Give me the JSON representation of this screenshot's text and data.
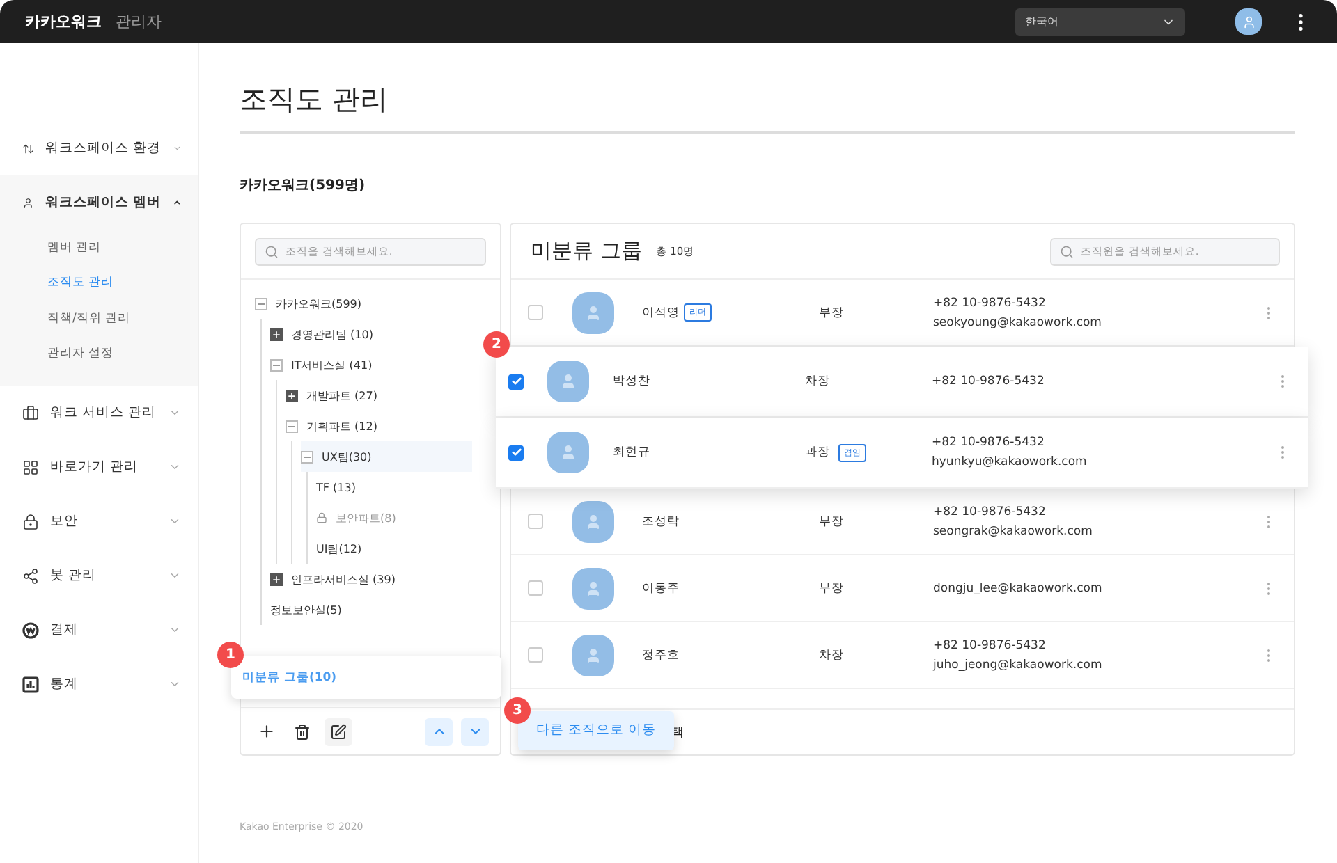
{
  "topbar": {
    "brand": "카카오워크",
    "subtitle": "관리자",
    "language": "한국어"
  },
  "sidebar": {
    "items": [
      {
        "label": "워크스페이스 환경",
        "expanded": false
      },
      {
        "label": "워크스페이스 멤버",
        "expanded": true,
        "children": [
          {
            "label": "멤버 관리",
            "selected": false
          },
          {
            "label": "조직도 관리",
            "selected": true
          },
          {
            "label": "직책/직위 관리",
            "selected": false
          },
          {
            "label": "관리자 설정",
            "selected": false
          }
        ]
      },
      {
        "label": "워크 서비스 관리",
        "expanded": false
      },
      {
        "label": "바로가기 관리",
        "expanded": false
      },
      {
        "label": "보안",
        "expanded": false
      },
      {
        "label": "봇 관리",
        "expanded": false
      },
      {
        "label": "결제",
        "expanded": false
      },
      {
        "label": "통계",
        "expanded": false
      }
    ]
  },
  "page": {
    "title": "조직도 관리",
    "org_label": "카카오워크(599명)",
    "footer": "Kakao Enterprise © 2020"
  },
  "tree_panel": {
    "search_placeholder": "조직을 검색해보세요.",
    "tree": [
      {
        "label": "카카오워크(599)",
        "expanded": true,
        "selected": false,
        "locked": false,
        "children": [
          {
            "label": "경영관리팀 (10)",
            "expanded": false,
            "selected": false,
            "locked": false
          },
          {
            "label": "IT서비스실 (41)",
            "expanded": true,
            "selected": false,
            "locked": false,
            "children": [
              {
                "label": "개발파트 (27)",
                "expanded": false,
                "selected": false,
                "locked": false
              },
              {
                "label": "기획파트 (12)",
                "expanded": true,
                "selected": false,
                "locked": false,
                "children": [
                  {
                    "label": "UX팀(30)",
                    "expanded": true,
                    "selected": true,
                    "locked": false,
                    "children": [
                      {
                        "label": "TF (13)",
                        "selected": false,
                        "locked": false
                      },
                      {
                        "label": "보안파트(8)",
                        "selected": false,
                        "locked": true
                      },
                      {
                        "label": "UI팀(12)",
                        "selected": false,
                        "locked": false
                      }
                    ]
                  }
                ]
              }
            ]
          },
          {
            "label": "인프라서비스실 (39)",
            "expanded": false,
            "selected": false,
            "locked": false
          },
          {
            "label": "정보보안실(5)",
            "selected": false,
            "locked": false
          }
        ]
      }
    ],
    "unassigned": {
      "label": "미분류 그룹(10)",
      "selected": true,
      "callout": "1"
    }
  },
  "member_panel": {
    "title": "미분류 그룹",
    "count": "총 10명",
    "search_placeholder": "조직원을 검색해보세요.",
    "callout": "2",
    "members": [
      {
        "name": "이석영",
        "badge": "리더",
        "position": "부장",
        "phone": "+82 10-9876-5432",
        "email": "seokyoung@kakaowork.com",
        "checked": false
      },
      {
        "name": "박성찬",
        "position": "차장",
        "phone": "+82 10-9876-5432",
        "checked": true
      },
      {
        "name": "최현규",
        "position": "과장",
        "position_badge": "겸임",
        "phone": "+82 10-9876-5432",
        "email": "hyunkyu@kakaowork.com",
        "checked": true
      },
      {
        "name": "조성락",
        "position": "부장",
        "phone": "+82 10-9876-5432",
        "email": "seongrak@kakaowork.com",
        "checked": false
      },
      {
        "name": "이동주",
        "position": "부장",
        "email": "dongju_lee@kakaowork.com",
        "checked": false
      },
      {
        "name": "정주호",
        "position": "차장",
        "phone": "+82 10-9876-5432",
        "email": "juho_jeong@kakaowork.com",
        "checked": false
      }
    ],
    "move_button": {
      "label": "다른 조직으로 이동",
      "callout": "3"
    },
    "footer_text": "택"
  }
}
